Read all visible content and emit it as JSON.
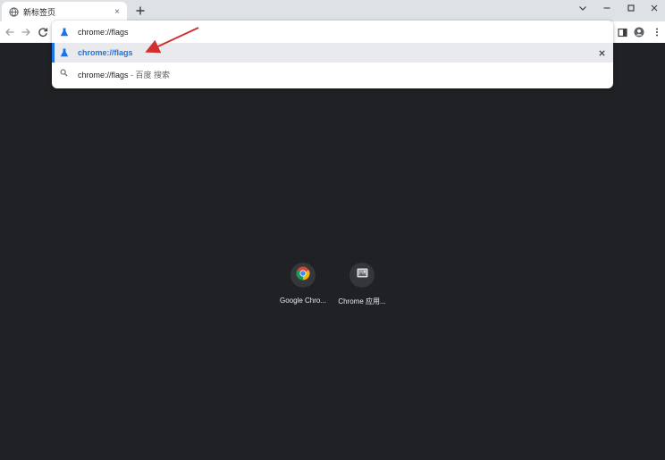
{
  "tab": {
    "title": "新标签页",
    "favicon": "globe-icon",
    "close_label": "×"
  },
  "toolbar": {
    "back": "back-arrow-icon",
    "forward": "forward-arrow-icon",
    "reload": "reload-icon",
    "side_panel": "side-panel-icon",
    "profile": "profile-icon",
    "menu": "kebab-menu-icon"
  },
  "omnibox": {
    "input_value": "chrome://flags",
    "suggestions": [
      {
        "text": "chrome://flags",
        "icon": "flask-icon",
        "selected": true
      },
      {
        "text": "chrome://flags",
        "suffix": " - 百度 搜索",
        "icon": "search-icon",
        "selected": false
      }
    ]
  },
  "shortcuts": [
    {
      "label": "Google Chro...",
      "icon": "chrome-logo-icon"
    },
    {
      "label": "Chrome 应用...",
      "icon": "apps-image-icon"
    }
  ],
  "colors": {
    "page_bg": "#202124",
    "accent": "#1a73e8",
    "annotation_arrow": "#d32f2f"
  }
}
